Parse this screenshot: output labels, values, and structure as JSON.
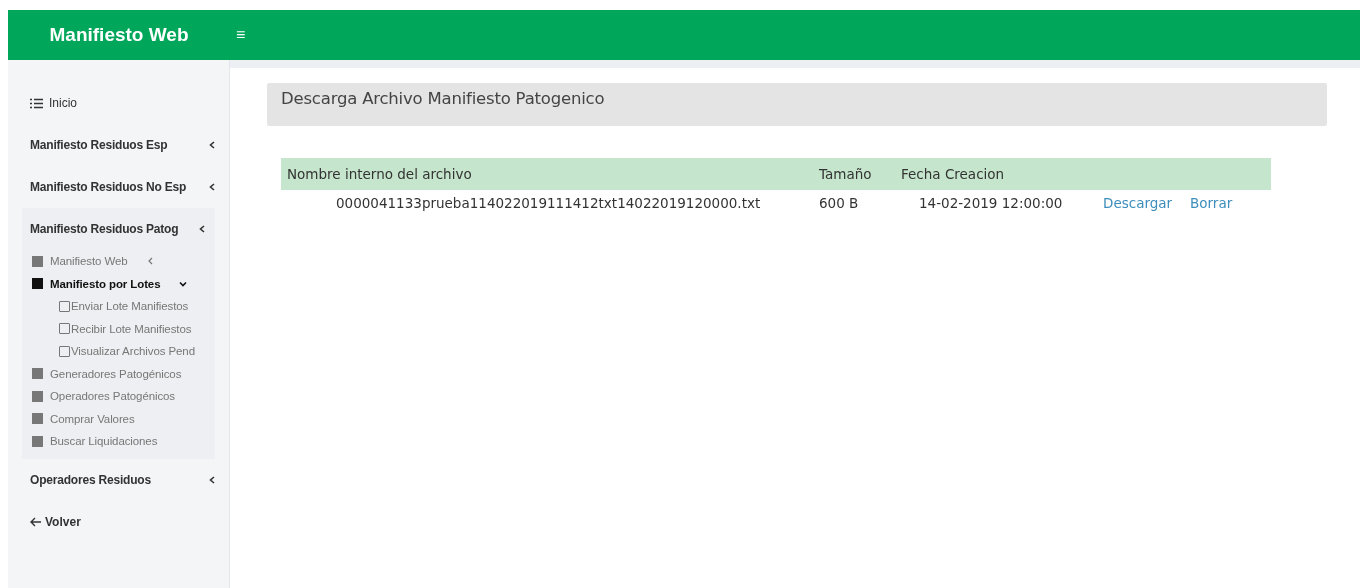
{
  "header": {
    "brand": "Manifiesto Web",
    "menu_icon": "≡"
  },
  "sidebar": {
    "items": [
      {
        "kind": "home",
        "label": "Inicio"
      },
      {
        "kind": "section",
        "label": "Manifiesto Residuos Esp",
        "submenu": true
      },
      {
        "kind": "section",
        "label": "Manifiesto Residuos No Esp",
        "submenu": true
      },
      {
        "kind": "section",
        "label": "Manifiesto Residuos Patog",
        "submenu": true,
        "children": [
          {
            "label": "Manifiesto Web",
            "selected": false,
            "submenu": true,
            "expanded": false
          },
          {
            "label": "Manifiesto por Lotes",
            "selected": true,
            "submenu": true,
            "expanded": true,
            "children": [
              {
                "label": "Enviar Lote Manifiestos"
              },
              {
                "label": "Recibir Lote Manifiestos"
              },
              {
                "label": "Visualizar Archivos Pend"
              }
            ]
          },
          {
            "label": "Generadores Patogénicos",
            "selected": false
          },
          {
            "label": "Operadores Patogénicos",
            "selected": false
          },
          {
            "label": "Comprar Valores",
            "selected": false
          },
          {
            "label": "Buscar Liquidaciones",
            "selected": false
          }
        ]
      },
      {
        "kind": "section",
        "label": "Operadores Residuos",
        "submenu": true
      },
      {
        "kind": "back",
        "label": "Volver"
      }
    ]
  },
  "panel": {
    "title": "Descarga Archivo Manifiesto Patogenico"
  },
  "table": {
    "columns": [
      "Nombre interno del archivo",
      "Tamaño",
      "Fecha Creacion"
    ],
    "rows": [
      {
        "name": "0000041133prueba114022019111412txt14022019120000.txt",
        "size": "600 B",
        "date": "14-02-2019 12:00:00",
        "actions": [
          "Descargar",
          "Borrar"
        ]
      }
    ]
  }
}
